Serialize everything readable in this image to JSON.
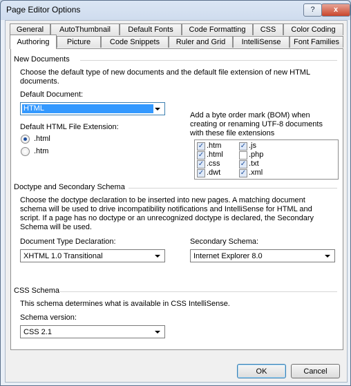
{
  "window": {
    "title": "Page Editor Options",
    "help_label": "?",
    "close_label": "x"
  },
  "tabs_row1": [
    "General",
    "AutoThumbnail",
    "Default Fonts",
    "Code Formatting",
    "CSS",
    "Color Coding"
  ],
  "tabs_row2": [
    "Authoring",
    "Picture",
    "Code Snippets",
    "Ruler and Grid",
    "IntelliSense",
    "Font Families"
  ],
  "active_tab": "Authoring",
  "new_documents": {
    "heading": "New Documents",
    "description": "Choose the default type of new documents and the default file extension of new HTML documents.",
    "default_document_label": "Default Document:",
    "default_document_value": "HTML",
    "ext_label": "Default HTML File Extension:",
    "ext_options": [
      {
        "label": ".html",
        "checked": true
      },
      {
        "label": ".htm",
        "checked": false
      }
    ],
    "bom_label": "Add a byte order mark (BOM) when creating or renaming UTF-8 documents with these file extensions",
    "bom_extensions": [
      {
        "label": ".htm",
        "checked": true
      },
      {
        "label": ".js",
        "checked": true
      },
      {
        "label": ".html",
        "checked": true
      },
      {
        "label": ".php",
        "checked": false
      },
      {
        "label": ".css",
        "checked": true
      },
      {
        "label": ".txt",
        "checked": true
      },
      {
        "label": ".dwt",
        "checked": true
      },
      {
        "label": ".xml",
        "checked": true
      }
    ]
  },
  "doctype": {
    "heading": "Doctype and Secondary Schema",
    "description": "Choose the doctype declaration to be inserted into new pages. A matching document schema will be used to drive incompatibility notifications and IntelliSense for HTML and script. If a page has no doctype or an unrecognized doctype is declared, the Secondary Schema will be used.",
    "doctype_label": "Document Type Declaration:",
    "doctype_value": "XHTML 1.0 Transitional",
    "secondary_label": "Secondary Schema:",
    "secondary_value": "Internet Explorer 8.0"
  },
  "css_schema": {
    "heading": "CSS Schema",
    "description": "This schema determines what is available in CSS IntelliSense.",
    "version_label": "Schema version:",
    "version_value": "CSS 2.1"
  },
  "buttons": {
    "ok": "OK",
    "cancel": "Cancel"
  },
  "check_glyph": "✓"
}
